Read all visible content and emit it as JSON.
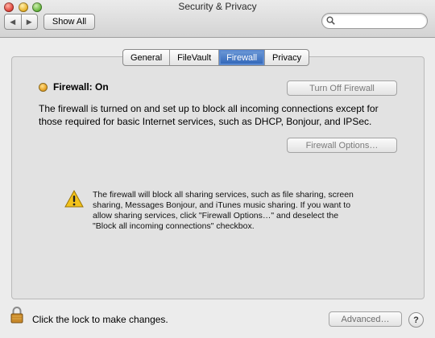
{
  "window": {
    "title": "Security & Privacy",
    "nav": {
      "back_label": "◀",
      "forward_label": "▶"
    },
    "show_all_label": "Show All",
    "search": {
      "placeholder": "",
      "value": ""
    }
  },
  "tabs": [
    {
      "label": "General",
      "active": false
    },
    {
      "label": "FileVault",
      "active": false
    },
    {
      "label": "Firewall",
      "active": true
    },
    {
      "label": "Privacy",
      "active": false
    }
  ],
  "firewall": {
    "status_text": "Firewall: On",
    "status_color": "#e8a52a",
    "turn_off_label": "Turn Off Firewall",
    "description": "The firewall is turned on and set up to block all incoming connections except for those required for basic Internet services, such as DHCP, Bonjour, and IPSec.",
    "options_label": "Firewall Options…",
    "warning_text": "The firewall will block all sharing services, such as file sharing, screen sharing, Messages Bonjour, and iTunes music sharing.  If you want to allow sharing services, click \"Firewall Options…\" and deselect the \"Block all incoming connections\" checkbox."
  },
  "footer": {
    "lock_text": "Click the lock to make changes.",
    "advanced_label": "Advanced…",
    "help_label": "?"
  },
  "icons": {
    "search": "search-icon",
    "warning": "warning-icon",
    "lock": "lock-icon"
  }
}
